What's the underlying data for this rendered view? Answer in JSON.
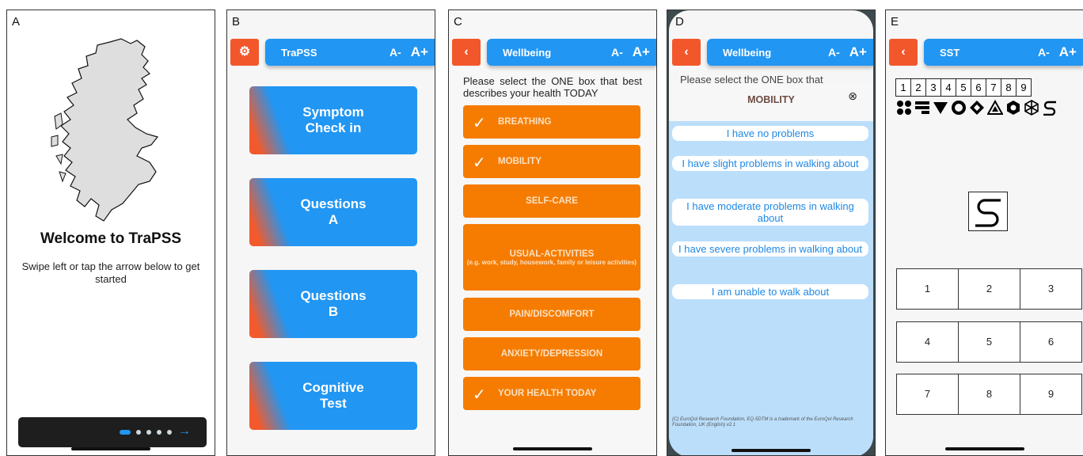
{
  "panels": {
    "a": "A",
    "b": "B",
    "c": "C",
    "d": "D",
    "e": "E"
  },
  "screenA": {
    "welcome": "Welcome to TraPSS",
    "instructions": "Swipe left or tap the arrow below to get started",
    "next_icon": "arrow-right-icon",
    "page_count": 5,
    "active_page": 1
  },
  "screenB": {
    "title": "TraPSS",
    "font_decrease": "A-",
    "font_increase": "A+",
    "settings_icon": "gear-icon",
    "buttons": [
      "Symptom\nCheck in",
      "Questions\nA",
      "Questions\nB",
      "Cognitive\nTest"
    ]
  },
  "screenC": {
    "title": "Wellbeing",
    "font_decrease": "A-",
    "font_increase": "A+",
    "instruction": "Please select the ONE box that best describes your health TODAY",
    "options": [
      {
        "label": "BREATHING",
        "checked": true
      },
      {
        "label": "MOBILITY",
        "checked": true
      },
      {
        "label": "SELF-CARE",
        "checked": false
      },
      {
        "label": "USUAL-ACTIVITIES",
        "sub": "(e.g. work, study, housework, family or leisure activities)",
        "checked": false
      },
      {
        "label": "PAIN/DISCOMFORT",
        "checked": false
      },
      {
        "label": "ANXIETY/DEPRESSION",
        "checked": false
      },
      {
        "label": "YOUR HEALTH TODAY",
        "checked": true
      }
    ]
  },
  "screenD": {
    "title": "Wellbeing",
    "font_decrease": "A-",
    "font_increase": "A+",
    "background_text": "Please select the ONE box that",
    "modal_title": "MOBILITY",
    "close_icon": "close-circle-icon",
    "options": [
      "I have no problems",
      "I have slight problems in walking about",
      "I have moderate problems in walking about",
      "I have severe problems in walking about",
      "I am unable to walk about"
    ],
    "copyright": "(C) EuroQol Research Foundation, EQ-5DTM is a trademark of the EuroQol Research Foundation, UK (English) v2.1"
  },
  "screenE": {
    "title": "SST",
    "font_decrease": "A-",
    "font_increase": "A+",
    "key_numbers": [
      "1",
      "2",
      "3",
      "4",
      "5",
      "6",
      "7",
      "8",
      "9"
    ],
    "key_symbols": [
      "four-dots-icon",
      "bars-icon",
      "down-triangle-icon",
      "ring-icon",
      "diamond-icon",
      "triangle-in-triangle-icon",
      "hexagon-icon",
      "polyhedron-icon",
      "s-curve-icon"
    ],
    "target_symbol": "s-curve-icon",
    "keypad": [
      "1",
      "2",
      "3",
      "4",
      "5",
      "6",
      "7",
      "8",
      "9"
    ]
  }
}
